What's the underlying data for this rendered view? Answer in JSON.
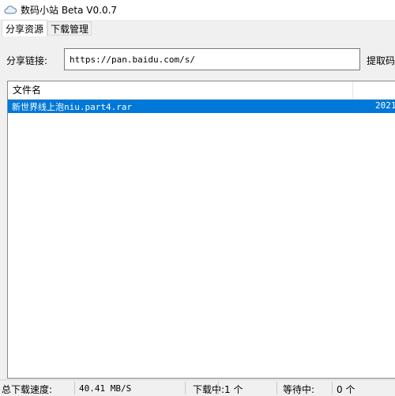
{
  "window": {
    "title": "数码小站 Beta V0.0.7",
    "icon": "cloud-icon"
  },
  "tabs": [
    {
      "label": "分享资源",
      "active": true
    },
    {
      "label": "下载管理",
      "active": false
    }
  ],
  "share": {
    "link_label": "分享链接:",
    "link_value": "https://pan.baidu.com/s/",
    "code_label": "提取码"
  },
  "list": {
    "columns": [
      "文件名"
    ],
    "rows": [
      {
        "name": "新世界线上泡niu.part4.rar",
        "date": "2021-",
        "selected": true
      }
    ]
  },
  "status": {
    "speed_label": "总下载速度:",
    "speed_value": "40.41 MB/S",
    "downloading_label": "下载中:",
    "downloading_value": "1 个",
    "waiting_label": "等待中:",
    "waiting_value": "0 个"
  },
  "colors": {
    "selection": "#0078d7",
    "panel_bg": "#f0f0f0"
  }
}
